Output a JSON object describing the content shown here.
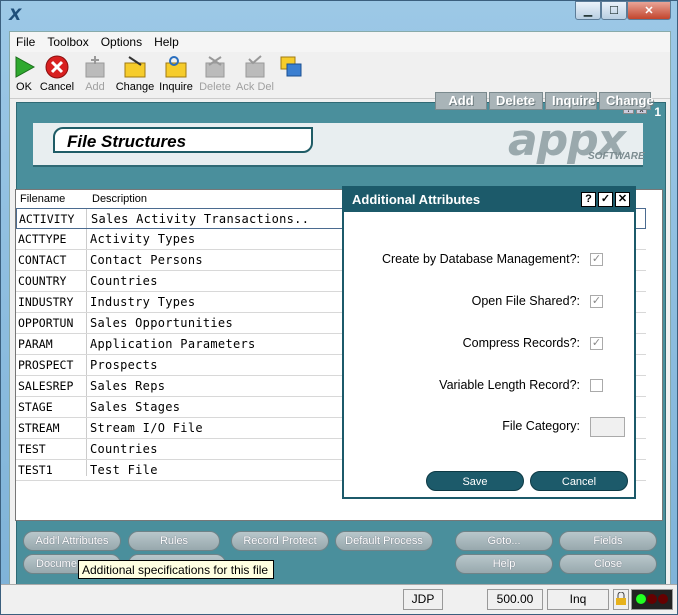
{
  "window": {
    "icon": "X",
    "minimize": "▁",
    "maximize": "☐",
    "close": "✕"
  },
  "menu": [
    "File",
    "Toolbox",
    "Options",
    "Help"
  ],
  "toolbar": [
    {
      "label": "OK",
      "icon": "ok-icon",
      "enabled": true
    },
    {
      "label": "Cancel",
      "icon": "cancel-icon",
      "enabled": true
    },
    {
      "label": "Add",
      "icon": "add-icon",
      "enabled": false
    },
    {
      "label": "Change",
      "icon": "change-icon",
      "enabled": true
    },
    {
      "label": "Inquire",
      "icon": "inquire-icon",
      "enabled": true
    },
    {
      "label": "Delete",
      "icon": "delete-icon",
      "enabled": false
    },
    {
      "label": "Ack Del",
      "icon": "ack-delete-icon",
      "enabled": false
    }
  ],
  "panel": {
    "title": "File Structures",
    "logo": "appx",
    "logo_sub": "SOFTWARE",
    "number": "1",
    "tabs": [
      "Add",
      "Delete",
      "Inquire",
      "Change"
    ]
  },
  "grid": {
    "headers": [
      "Filename",
      "Description"
    ],
    "rows": [
      {
        "name": "ACTIVITY",
        "desc": "Sales Activity Transactions.."
      },
      {
        "name": "ACTTYPE",
        "desc": "Activity Types"
      },
      {
        "name": "CONTACT",
        "desc": "Contact Persons"
      },
      {
        "name": "COUNTRY",
        "desc": "Countries"
      },
      {
        "name": "INDUSTRY",
        "desc": "Industry Types"
      },
      {
        "name": "OPPORTUN",
        "desc": "Sales Opportunities"
      },
      {
        "name": "PARAM",
        "desc": "Application Parameters"
      },
      {
        "name": "PROSPECT",
        "desc": "Prospects"
      },
      {
        "name": "SALESREP",
        "desc": "Sales Reps"
      },
      {
        "name": "STAGE",
        "desc": "Sales Stages"
      },
      {
        "name": "STREAM",
        "desc": "Stream I/O File"
      },
      {
        "name": "TEST",
        "desc": "Countries"
      },
      {
        "name": "TEST1",
        "desc": "Test File"
      }
    ]
  },
  "buttons": {
    "addl_attributes": "Add'l Attributes",
    "rules": "Rules",
    "record_protect": "Record Protect",
    "default_process": "Default Process",
    "goto": "Goto...",
    "fields": "Fields",
    "documentation": "Docume",
    "help": "Help",
    "close": "Close"
  },
  "tooltip": "Additional specifications for this file",
  "dialog": {
    "title": "Additional Attributes",
    "help": "?",
    "ok": "✓",
    "close": "✕",
    "fields": [
      {
        "label": "Create by Database Management?:",
        "checked": true
      },
      {
        "label": "Open File Shared?:",
        "checked": true
      },
      {
        "label": "Compress Records?:",
        "checked": true
      },
      {
        "label": "Variable Length Record?:",
        "checked": false
      }
    ],
    "category_label": "File Category:",
    "category_value": "",
    "save": "Save",
    "cancel": "Cancel"
  },
  "status": {
    "user": "JDP",
    "speed": "500.00",
    "mode": "Inq"
  }
}
